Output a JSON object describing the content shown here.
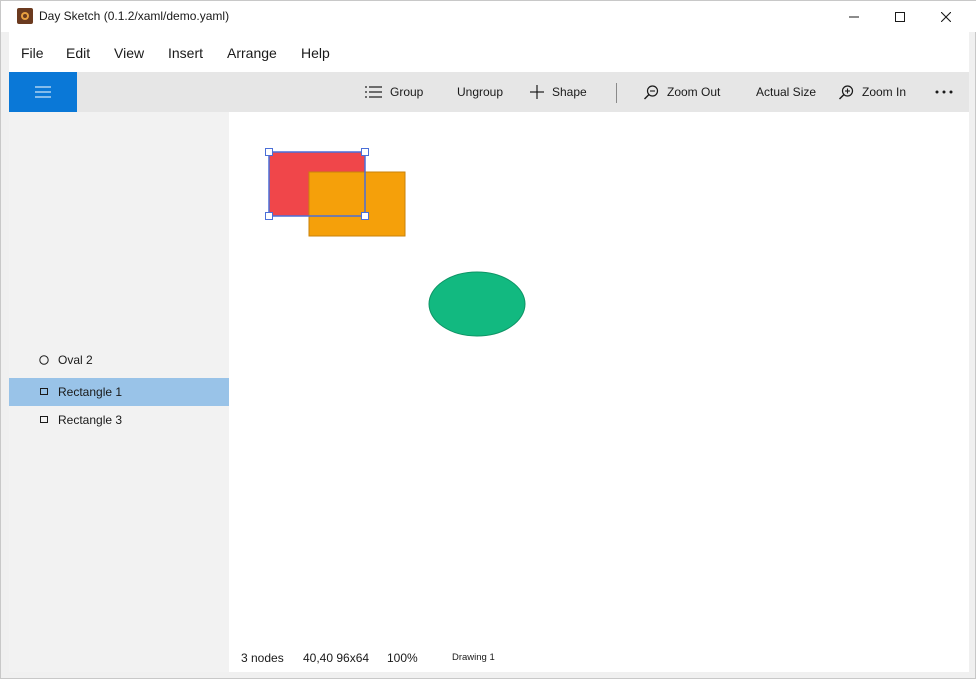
{
  "window": {
    "title": "Day Sketch (0.1.2/xaml/demo.yaml)",
    "icon": "app-icon",
    "controls": [
      "minimize-icon",
      "maximize-icon",
      "close-icon"
    ]
  },
  "menu": [
    "File",
    "Edit",
    "View",
    "Insert",
    "Arrange",
    "Help"
  ],
  "toolbar": {
    "menu_icon": "hamburger-icon",
    "accent": "#0a78d7",
    "group": "Group",
    "ungroup": "Ungroup",
    "shape": "Shape",
    "zoom_out": "Zoom Out",
    "actual_size": "Actual Size",
    "zoom_in": "Zoom In",
    "more_icon": "more-icon"
  },
  "layers": [
    {
      "label": "Oval 2",
      "icon": "oval-icon",
      "selected": false
    },
    {
      "label": "Rectangle 1",
      "icon": "rectangle-icon",
      "selected": true
    },
    {
      "label": "Rectangle 3",
      "icon": "rectangle-icon",
      "selected": false
    }
  ],
  "shapes": [
    {
      "name": "Rectangle 1",
      "kind": "rectangle",
      "fill": "#f0464a",
      "selected": true
    },
    {
      "name": "Rectangle 3",
      "kind": "rectangle",
      "fill": "#f5a00a"
    },
    {
      "name": "Oval 2",
      "kind": "ellipse",
      "fill": "#12b980"
    }
  ],
  "selection_color": "#4a6fd8",
  "status": {
    "nodes": "3 nodes",
    "geometry": "40,40 96x64",
    "zoom": "100%",
    "document": "Drawing 1"
  }
}
